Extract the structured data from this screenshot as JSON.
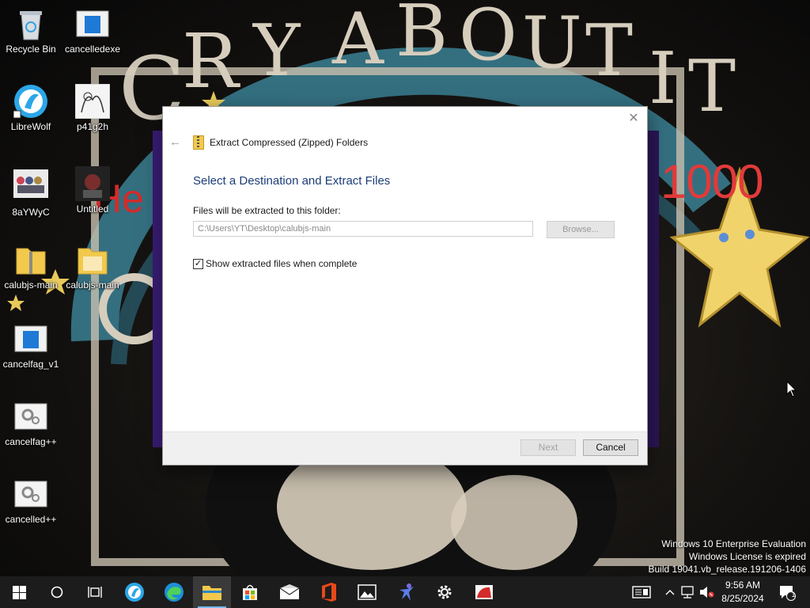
{
  "desktop": {
    "icons": [
      {
        "label": "Recycle Bin"
      },
      {
        "label": "cancelledexe"
      },
      {
        "label": "LibreWolf"
      },
      {
        "label": "p41g2h"
      },
      {
        "label": "8aYWyC"
      },
      {
        "label": "Untitled"
      },
      {
        "label": "calubjs-main"
      },
      {
        "label": "calubjs-main"
      },
      {
        "label": "cancelfag_v1"
      },
      {
        "label": "cancelfag++"
      },
      {
        "label": "cancelled++"
      }
    ],
    "wallpaper_text": {
      "big": "CRY ABOUT IT",
      "number": "1000",
      "partial": "He"
    }
  },
  "dialog": {
    "title": "Extract Compressed (Zipped) Folders",
    "heading": "Select a Destination and Extract Files",
    "dest_label": "Files will be extracted to this folder:",
    "dest_value": "C:\\Users\\YT\\Desktop\\calubjs-main",
    "browse_label": "Browse...",
    "show_files_label": "Show extracted files when complete",
    "show_files_checked": true,
    "next_label": "Next",
    "cancel_label": "Cancel",
    "close_glyph": "✕",
    "back_glyph": "←"
  },
  "watermark": {
    "line1": "Windows 10 Enterprise Evaluation",
    "line2": "Windows License is expired",
    "line3": "Build 19041.vb_release.191206-1406"
  },
  "taskbar": {
    "clock_time": "9:56 AM",
    "clock_date": "8/25/2024",
    "notification_count": "1",
    "accent": "#76b9ed"
  }
}
